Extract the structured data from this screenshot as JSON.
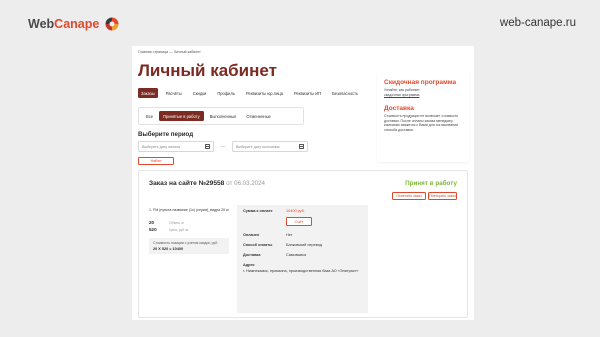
{
  "header": {
    "brand_part1": "Web",
    "brand_part2": "Canape",
    "site": "web-canape.ru"
  },
  "breadcrumbs": "Главная страница  —  Личный кабинет",
  "title": "Личный кабинет",
  "tabs": [
    {
      "label": "Заказы",
      "active": true
    },
    {
      "label": "Расчёты",
      "active": false
    },
    {
      "label": "Скидки",
      "active": false
    },
    {
      "label": "Профиль",
      "active": false
    },
    {
      "label": "Реквизиты юр.лица",
      "active": false
    },
    {
      "label": "Реквизиты ИП",
      "active": false
    },
    {
      "label": "Безопасность",
      "active": false
    }
  ],
  "subtabs": [
    {
      "label": "Все",
      "active": false
    },
    {
      "label": "Принятые в работу",
      "active": true
    },
    {
      "label": "Выполненные",
      "active": false
    },
    {
      "label": "Отмененные",
      "active": false
    }
  ],
  "period": {
    "heading": "Выберите период",
    "start_placeholder": "Выберите дату начала",
    "end_placeholder": "Выберите дату окончания",
    "separator": "—",
    "find_button": "Найти"
  },
  "order": {
    "title": "Заказ на сайте №29558",
    "date": "от 06.03.2024",
    "status": "Принят в работу",
    "cancel_button": "Отменить заказ",
    "repeat_button": "Повторить заказ",
    "product": {
      "name": "1. FM (пункта название (1x) (серия)_видра 20 кг",
      "qty1": "20",
      "qty1_label": "Объем, м",
      "qty2": "520",
      "qty2_label": "Цена, руб./м",
      "cost_label": "Стоимость позиции с учетом скидки, руб.",
      "cost_value": "20 Х 520 = 10400"
    },
    "summary": {
      "sum_label": "Сумма к оплате",
      "sum_value": "10400 руб.",
      "pay_button": "Счёт",
      "paid_label": "Оплачен",
      "paid_value": "Нет",
      "method_label": "Способ оплаты",
      "method_value": "Банковский перевод",
      "delivery_label": "Доставка",
      "delivery_value": "Самовывоз",
      "address_label": "Адрес",
      "address_value": "г. Нижнекамск, промзона, производственная база АО «Элитраст»"
    }
  },
  "sidebar": {
    "discount_title": "Скидочная программа",
    "discount_text": "Узнайте, как работает",
    "discount_link": "скидочная программа",
    "delivery_title": "Доставка",
    "delivery_text": "Стоимость продукции не включает стоимость доставки. После оплаты заказа менеджер компании свяжется с Вами для согласования способа доставки."
  },
  "colors": {
    "brand_dark": "#7b2b22",
    "accent": "#e0492b",
    "status_green": "#7fb539"
  }
}
